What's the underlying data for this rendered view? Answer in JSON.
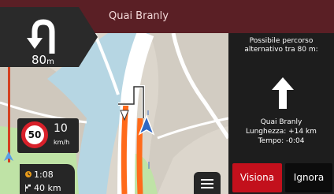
{
  "colors": {
    "top_bar": "#5a1f25",
    "route": "#ff6a1a",
    "water": "#b6d6e3",
    "land": "#dcd6cc",
    "park": "#bfe3a6",
    "accept": "#c3101c",
    "panel": "#262626"
  },
  "header": {
    "street_name": "Quai Branly"
  },
  "next_turn": {
    "icon": "u-turn-icon",
    "distance_value": "80",
    "distance_unit": "m"
  },
  "speed": {
    "limit": "50",
    "current": "10",
    "unit": "km/h"
  },
  "trip": {
    "time_icon": "clock-icon",
    "time": "1:08",
    "distance_icon": "flag-icon",
    "distance": "40 km"
  },
  "menu": {
    "icon": "menu-icon"
  },
  "alternative": {
    "title": "Possibile percorso alternativo tra 80 m:",
    "icon": "arrow-up-icon",
    "street": "Quai Branly",
    "length": "Lunghezza: +14 km",
    "time": "Tempo: -0:04",
    "view_label": "Visiona",
    "ignore_label": "Ignora"
  }
}
